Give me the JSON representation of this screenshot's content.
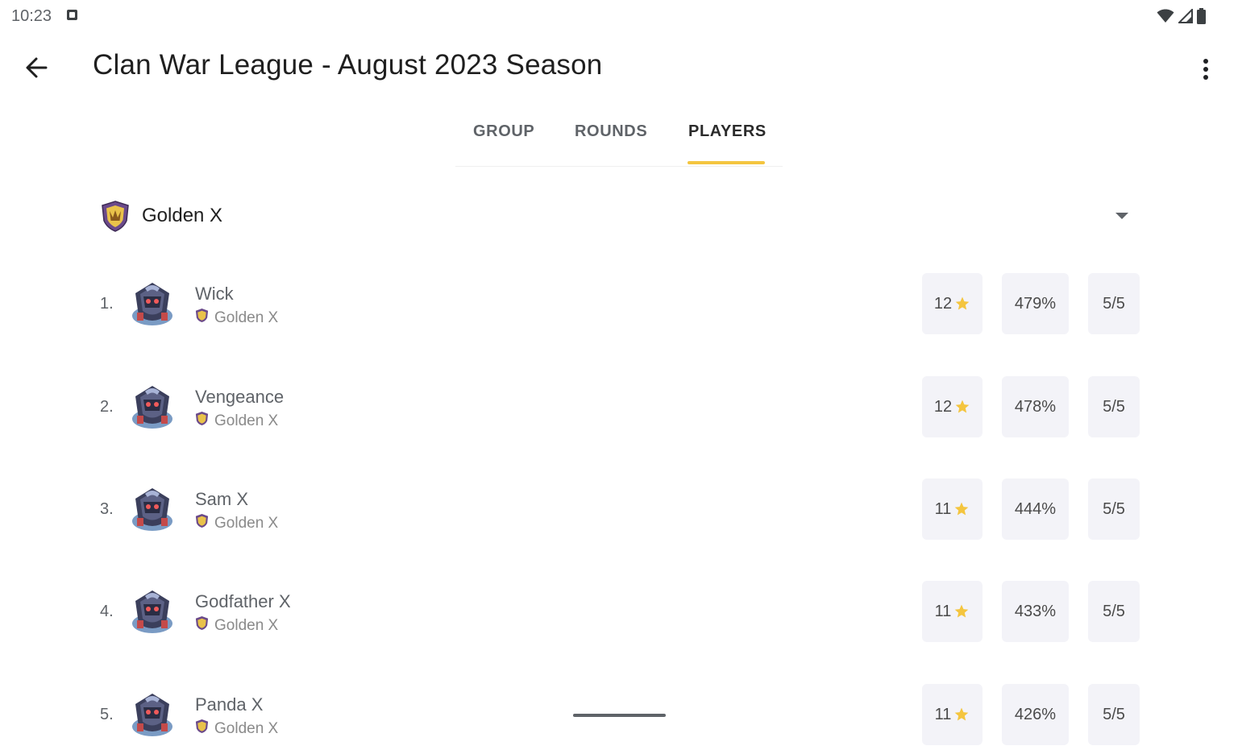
{
  "status_bar": {
    "time": "10:23"
  },
  "app_bar": {
    "title": "Clan War League - August 2023 Season"
  },
  "tabs": [
    {
      "label": "GROUP",
      "active": false
    },
    {
      "label": "ROUNDS",
      "active": false
    },
    {
      "label": "PLAYERS",
      "active": true
    }
  ],
  "clan_selector": {
    "selected": "Golden X"
  },
  "players": [
    {
      "rank": "1.",
      "name": "Wick",
      "clan": "Golden X",
      "stars": "12",
      "destruction": "479%",
      "attacks": "5/5"
    },
    {
      "rank": "2.",
      "name": "Vengeance",
      "clan": "Golden X",
      "stars": "12",
      "destruction": "478%",
      "attacks": "5/5"
    },
    {
      "rank": "3.",
      "name": "Sam X",
      "clan": "Golden X",
      "stars": "11",
      "destruction": "444%",
      "attacks": "5/5"
    },
    {
      "rank": "4.",
      "name": "Godfather X",
      "clan": "Golden X",
      "stars": "11",
      "destruction": "433%",
      "attacks": "5/5"
    },
    {
      "rank": "5.",
      "name": "Panda X",
      "clan": "Golden X",
      "stars": "11",
      "destruction": "426%",
      "attacks": "5/5"
    }
  ],
  "colors": {
    "accent": "#f4c53f",
    "stat_background": "#f3f3f8",
    "star": "#f4c53f"
  }
}
